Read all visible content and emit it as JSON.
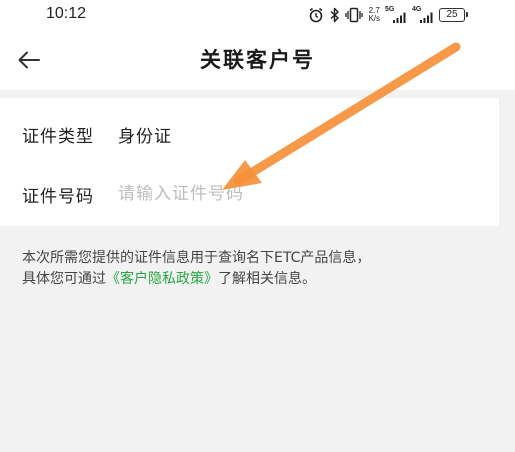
{
  "status_bar": {
    "time": "10:12",
    "net_speed_value": "2.7",
    "net_speed_unit": "K/s",
    "sim1_tag": "5G",
    "sim2_tag": "4G",
    "battery": "25",
    "icons": [
      "alarm-icon",
      "bluetooth-icon",
      "vibrate-icon",
      "signal-icon",
      "battery-icon"
    ]
  },
  "header": {
    "title": "关联客户号",
    "back_icon": "arrow-left-icon"
  },
  "form": {
    "id_type": {
      "label": "证件类型",
      "value": "身份证"
    },
    "id_number": {
      "label": "证件号码",
      "placeholder": "请输入证件号码",
      "value": ""
    }
  },
  "notice": {
    "line1": "本次所需您提供的证件信息用于查询名下ETC产品信息，",
    "line2_prefix": "具体您可通过",
    "policy_link": "《客户隐私政策》",
    "line2_suffix": "了解相关信息。"
  },
  "colors": {
    "link": "#27a844",
    "annotation_arrow": "#f5903a",
    "background": "#f2f2f2"
  }
}
